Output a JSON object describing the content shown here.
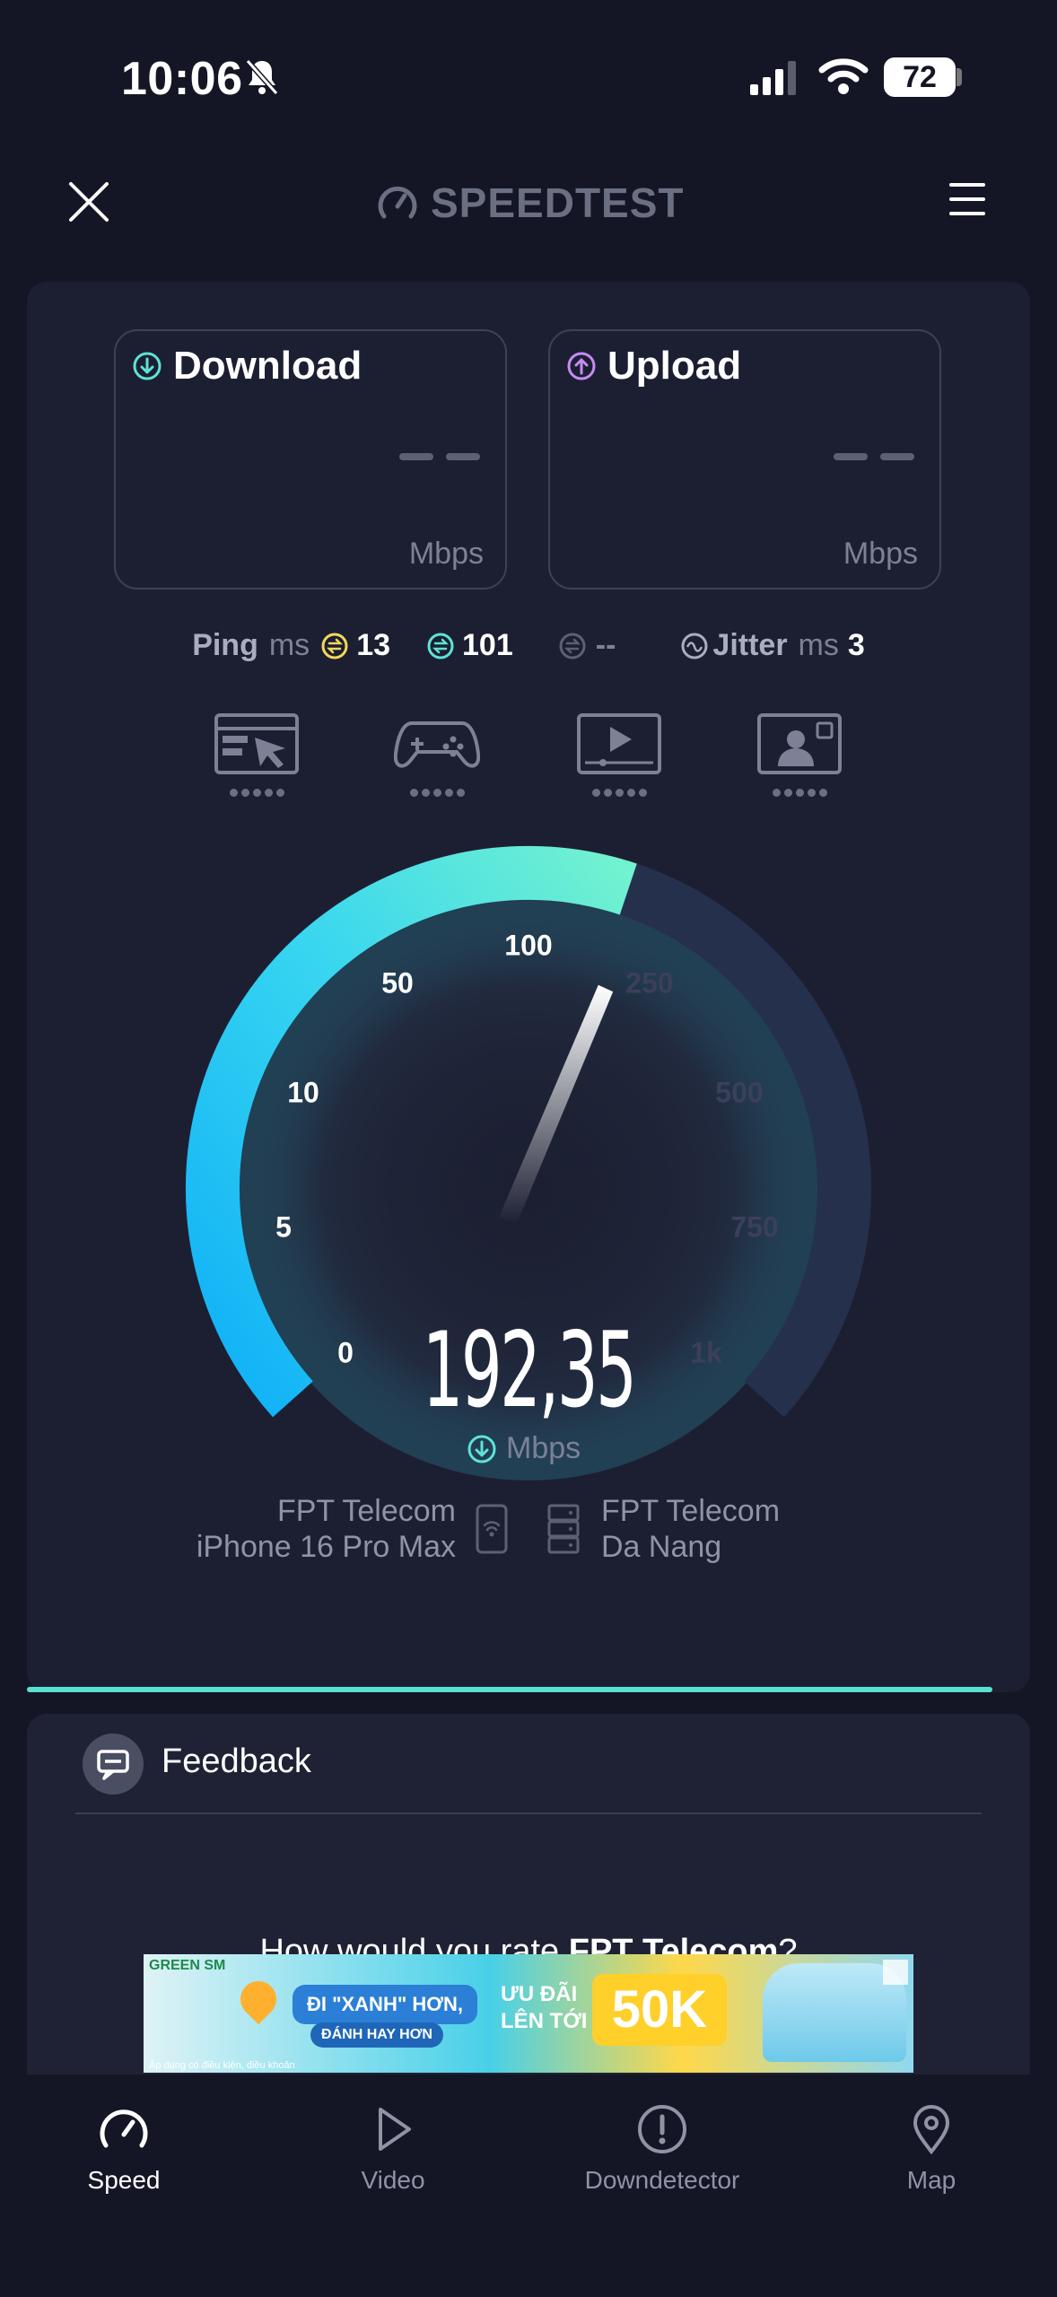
{
  "status_bar": {
    "time": "10:06",
    "battery": "72",
    "icons": [
      "bell-slash-icon",
      "signal-icon",
      "wifi-icon",
      "battery-icon"
    ]
  },
  "header": {
    "brand": "SPEEDTEST",
    "close_icon": "close-icon",
    "menu_icon": "hamburger-menu-icon"
  },
  "download": {
    "label": "Download",
    "value": "– –",
    "unit": "Mbps"
  },
  "upload": {
    "label": "Upload",
    "value": "– –",
    "unit": "Mbps"
  },
  "ping": {
    "label": "Ping",
    "unit": "ms",
    "idle": "13",
    "download": "101",
    "upload": "--"
  },
  "jitter": {
    "label": "Jitter",
    "unit": "ms",
    "value": "3"
  },
  "activities": [
    {
      "icon": "web-browsing-icon"
    },
    {
      "icon": "gaming-icon"
    },
    {
      "icon": "video-streaming-icon"
    },
    {
      "icon": "video-call-icon"
    }
  ],
  "gauge": {
    "labels": [
      "0",
      "5",
      "10",
      "50",
      "100",
      "250",
      "500",
      "750",
      "1k"
    ],
    "current_speed": "192,35",
    "unit": "Mbps",
    "colors": {
      "active_start": "#10b3f5",
      "active_end": "#6ff0d0",
      "inactive": "#25304d"
    }
  },
  "client": {
    "isp": "FPT Telecom",
    "device": "iPhone 16 Pro Max"
  },
  "server": {
    "isp": "FPT Telecom",
    "location": "Da Nang"
  },
  "feedback": {
    "title": "Feedback",
    "question_prefix": "How would you rate ",
    "question_isp": "FPT Telecom",
    "question_suffix": "?"
  },
  "ad": {
    "brand": "GREEN SM",
    "pill1": "ĐI \"XANH\" HƠN,",
    "pill2": "ĐÁNH HAY HƠN",
    "offer1": "ƯU ĐÃI",
    "offer2": "LÊN TỚI",
    "amount": "50K",
    "footnote": "Áp dụng có điều kiện, điều khoản"
  },
  "nav": {
    "items": [
      {
        "label": "Speed",
        "icon": "speedometer-icon",
        "active": true
      },
      {
        "label": "Video",
        "icon": "play-icon",
        "active": false
      },
      {
        "label": "Downdetector",
        "icon": "alert-icon",
        "active": false
      },
      {
        "label": "Map",
        "icon": "map-pin-icon",
        "active": false
      }
    ]
  }
}
